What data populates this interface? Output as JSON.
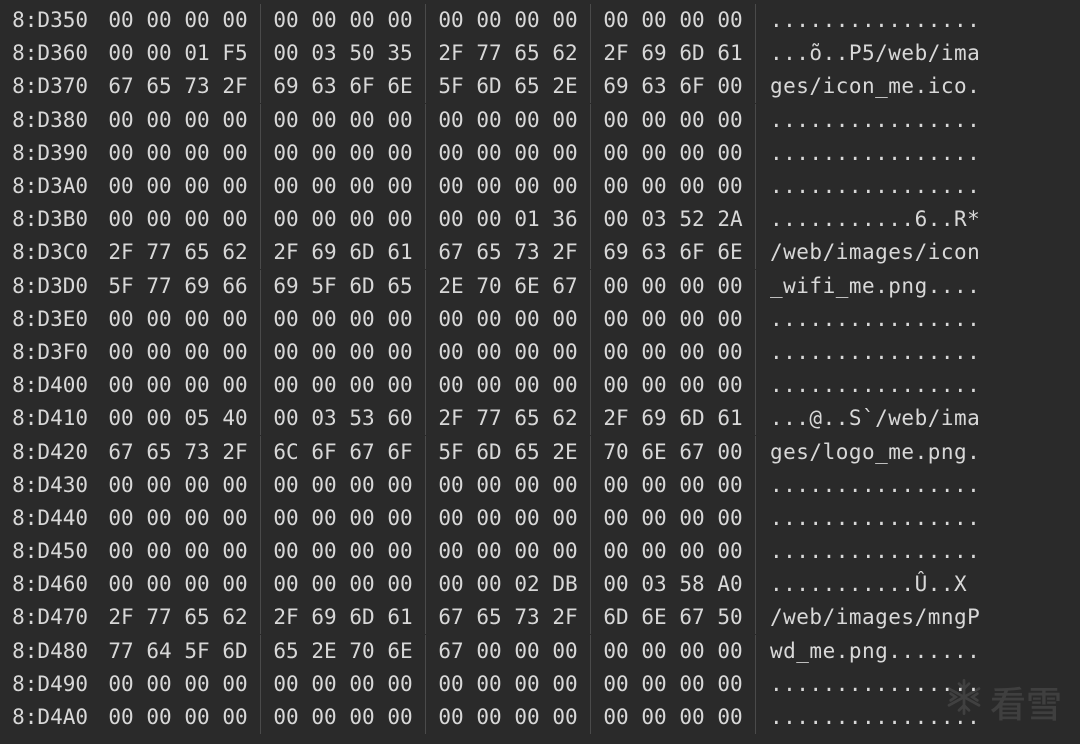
{
  "watermark": {
    "text": "看雪"
  },
  "rows": [
    {
      "offset": "8:D350",
      "bytes": [
        "00",
        "00",
        "00",
        "00",
        "00",
        "00",
        "00",
        "00",
        "00",
        "00",
        "00",
        "00",
        "00",
        "00",
        "00",
        "00"
      ],
      "ascii": "................"
    },
    {
      "offset": "8:D360",
      "bytes": [
        "00",
        "00",
        "01",
        "F5",
        "00",
        "03",
        "50",
        "35",
        "2F",
        "77",
        "65",
        "62",
        "2F",
        "69",
        "6D",
        "61"
      ],
      "ascii": "...õ..P5/web/ima"
    },
    {
      "offset": "8:D370",
      "bytes": [
        "67",
        "65",
        "73",
        "2F",
        "69",
        "63",
        "6F",
        "6E",
        "5F",
        "6D",
        "65",
        "2E",
        "69",
        "63",
        "6F",
        "00"
      ],
      "ascii": "ges/icon_me.ico."
    },
    {
      "offset": "8:D380",
      "bytes": [
        "00",
        "00",
        "00",
        "00",
        "00",
        "00",
        "00",
        "00",
        "00",
        "00",
        "00",
        "00",
        "00",
        "00",
        "00",
        "00"
      ],
      "ascii": "................"
    },
    {
      "offset": "8:D390",
      "bytes": [
        "00",
        "00",
        "00",
        "00",
        "00",
        "00",
        "00",
        "00",
        "00",
        "00",
        "00",
        "00",
        "00",
        "00",
        "00",
        "00"
      ],
      "ascii": "................"
    },
    {
      "offset": "8:D3A0",
      "bytes": [
        "00",
        "00",
        "00",
        "00",
        "00",
        "00",
        "00",
        "00",
        "00",
        "00",
        "00",
        "00",
        "00",
        "00",
        "00",
        "00"
      ],
      "ascii": "................"
    },
    {
      "offset": "8:D3B0",
      "bytes": [
        "00",
        "00",
        "00",
        "00",
        "00",
        "00",
        "00",
        "00",
        "00",
        "00",
        "01",
        "36",
        "00",
        "03",
        "52",
        "2A"
      ],
      "ascii": "...........6..R*"
    },
    {
      "offset": "8:D3C0",
      "bytes": [
        "2F",
        "77",
        "65",
        "62",
        "2F",
        "69",
        "6D",
        "61",
        "67",
        "65",
        "73",
        "2F",
        "69",
        "63",
        "6F",
        "6E"
      ],
      "ascii": "/web/images/icon"
    },
    {
      "offset": "8:D3D0",
      "bytes": [
        "5F",
        "77",
        "69",
        "66",
        "69",
        "5F",
        "6D",
        "65",
        "2E",
        "70",
        "6E",
        "67",
        "00",
        "00",
        "00",
        "00"
      ],
      "ascii": "_wifi_me.png...."
    },
    {
      "offset": "8:D3E0",
      "bytes": [
        "00",
        "00",
        "00",
        "00",
        "00",
        "00",
        "00",
        "00",
        "00",
        "00",
        "00",
        "00",
        "00",
        "00",
        "00",
        "00"
      ],
      "ascii": "................"
    },
    {
      "offset": "8:D3F0",
      "bytes": [
        "00",
        "00",
        "00",
        "00",
        "00",
        "00",
        "00",
        "00",
        "00",
        "00",
        "00",
        "00",
        "00",
        "00",
        "00",
        "00"
      ],
      "ascii": "................"
    },
    {
      "offset": "8:D400",
      "bytes": [
        "00",
        "00",
        "00",
        "00",
        "00",
        "00",
        "00",
        "00",
        "00",
        "00",
        "00",
        "00",
        "00",
        "00",
        "00",
        "00"
      ],
      "ascii": "................"
    },
    {
      "offset": "8:D410",
      "bytes": [
        "00",
        "00",
        "05",
        "40",
        "00",
        "03",
        "53",
        "60",
        "2F",
        "77",
        "65",
        "62",
        "2F",
        "69",
        "6D",
        "61"
      ],
      "ascii": "...@..S`/web/ima"
    },
    {
      "offset": "8:D420",
      "bytes": [
        "67",
        "65",
        "73",
        "2F",
        "6C",
        "6F",
        "67",
        "6F",
        "5F",
        "6D",
        "65",
        "2E",
        "70",
        "6E",
        "67",
        "00"
      ],
      "ascii": "ges/logo_me.png."
    },
    {
      "offset": "8:D430",
      "bytes": [
        "00",
        "00",
        "00",
        "00",
        "00",
        "00",
        "00",
        "00",
        "00",
        "00",
        "00",
        "00",
        "00",
        "00",
        "00",
        "00"
      ],
      "ascii": "................"
    },
    {
      "offset": "8:D440",
      "bytes": [
        "00",
        "00",
        "00",
        "00",
        "00",
        "00",
        "00",
        "00",
        "00",
        "00",
        "00",
        "00",
        "00",
        "00",
        "00",
        "00"
      ],
      "ascii": "................"
    },
    {
      "offset": "8:D450",
      "bytes": [
        "00",
        "00",
        "00",
        "00",
        "00",
        "00",
        "00",
        "00",
        "00",
        "00",
        "00",
        "00",
        "00",
        "00",
        "00",
        "00"
      ],
      "ascii": "................"
    },
    {
      "offset": "8:D460",
      "bytes": [
        "00",
        "00",
        "00",
        "00",
        "00",
        "00",
        "00",
        "00",
        "00",
        "00",
        "02",
        "DB",
        "00",
        "03",
        "58",
        "A0"
      ],
      "ascii": "...........Û..X "
    },
    {
      "offset": "8:D470",
      "bytes": [
        "2F",
        "77",
        "65",
        "62",
        "2F",
        "69",
        "6D",
        "61",
        "67",
        "65",
        "73",
        "2F",
        "6D",
        "6E",
        "67",
        "50"
      ],
      "ascii": "/web/images/mngP"
    },
    {
      "offset": "8:D480",
      "bytes": [
        "77",
        "64",
        "5F",
        "6D",
        "65",
        "2E",
        "70",
        "6E",
        "67",
        "00",
        "00",
        "00",
        "00",
        "00",
        "00",
        "00"
      ],
      "ascii": "wd_me.png......."
    },
    {
      "offset": "8:D490",
      "bytes": [
        "00",
        "00",
        "00",
        "00",
        "00",
        "00",
        "00",
        "00",
        "00",
        "00",
        "00",
        "00",
        "00",
        "00",
        "00",
        "00"
      ],
      "ascii": "................"
    },
    {
      "offset": "8:D4A0",
      "bytes": [
        "00",
        "00",
        "00",
        "00",
        "00",
        "00",
        "00",
        "00",
        "00",
        "00",
        "00",
        "00",
        "00",
        "00",
        "00",
        "00"
      ],
      "ascii": "................"
    }
  ]
}
